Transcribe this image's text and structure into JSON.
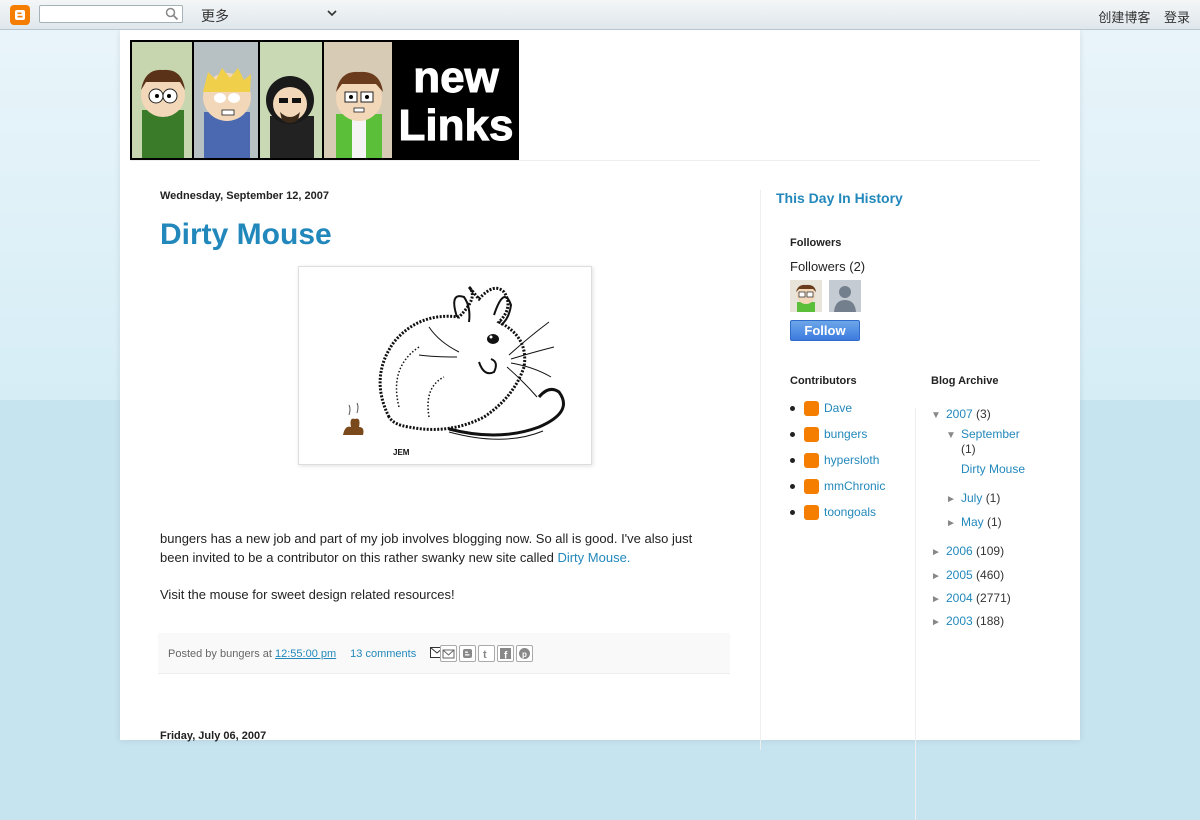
{
  "navbar": {
    "logo_icon": "blogger-icon",
    "search_placeholder": "",
    "more_label": "更多",
    "create_blog": "创建博客",
    "sign_in": "登录"
  },
  "header": {
    "banner_text": "new Links"
  },
  "post1": {
    "date": "Wednesday, September 12, 2007",
    "title": "Dirty Mouse",
    "image_signature": "JEM",
    "body_p1_text": "bungers has a new job and part of my job involves blogging now. So all is good. I've also just been invited to be a contributor on this rather swanky new site called ",
    "body_p1_link": "Dirty Mouse.",
    "body_p2": "Visit the mouse for sweet design related resources!",
    "footer_posted_by": "Posted by bungers at ",
    "footer_time": "12:55:00 pm",
    "footer_comments": "13 comments"
  },
  "post2": {
    "date": "Friday, July 06, 2007"
  },
  "sidebar": {
    "this_day_title": "This Day In History",
    "followers_title": "Followers",
    "followers_count": "Followers (2)",
    "follow_button": "Follow",
    "contributors_title": "Contributors",
    "contributors": [
      "Dave",
      "bungers",
      "hypersloth",
      "mmChronic",
      "toongoals"
    ],
    "archive_title": "Blog Archive",
    "archive": {
      "y2007": {
        "label": "2007",
        "count": "(3)"
      },
      "sep": {
        "label": "September",
        "count": "(1)"
      },
      "sep_post": "Dirty Mouse",
      "jul": {
        "label": "July",
        "count": "(1)"
      },
      "may": {
        "label": "May",
        "count": "(1)"
      },
      "y2006": {
        "label": "2006",
        "count": "(109)"
      },
      "y2005": {
        "label": "2005",
        "count": "(460)"
      },
      "y2004": {
        "label": "2004",
        "count": "(2771)"
      },
      "y2003": {
        "label": "2003",
        "count": "(188)"
      }
    }
  },
  "colors": {
    "link": "#2288bb",
    "blogger_orange": "#f57d00",
    "follow_blue": "#3d7be0"
  }
}
